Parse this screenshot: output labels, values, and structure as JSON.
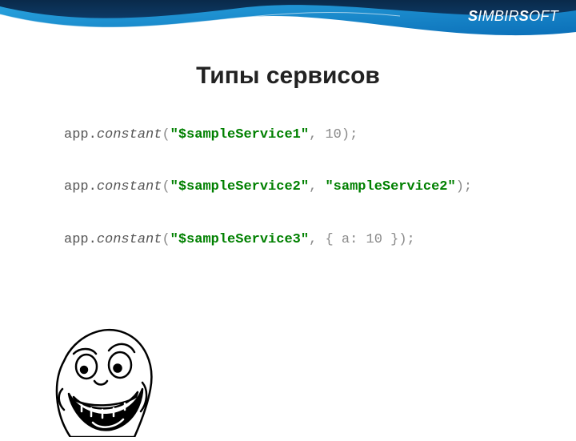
{
  "logo": {
    "part1": "S",
    "part2": "IMBIR",
    "part3": "S",
    "part4": "OFT"
  },
  "title": "Типы сервисов",
  "code": {
    "line1": {
      "pre": "app.",
      "fn": "constant",
      "open": "(",
      "arg1": "\"$sampleService1\"",
      "sep": ", ",
      "arg2": "10",
      "close": ");"
    },
    "line2": {
      "pre": "app.",
      "fn": "constant",
      "open": "(",
      "arg1": "\"$sampleService2\"",
      "sep": ", ",
      "arg2": "\"sampleService2\"",
      "close": ");"
    },
    "line3": {
      "pre": "app.",
      "fn": "constant",
      "open": "(",
      "arg1": "\"$sampleService3\"",
      "sep": ", ",
      "arg2": "{ a: 10 }",
      "close": ");"
    }
  }
}
